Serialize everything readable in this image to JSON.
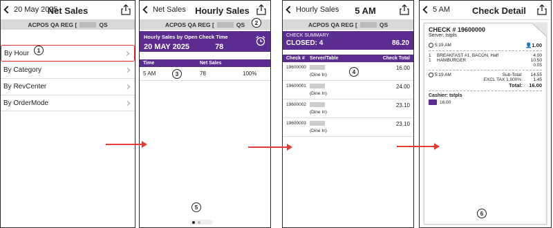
{
  "screen1": {
    "back_label": "20 May 2025",
    "title": "Net Sales",
    "reg_prefix": "ACPOS QA REG [",
    "reg_suffix": "QS",
    "items": [
      {
        "label": "By Hour"
      },
      {
        "label": "By Category"
      },
      {
        "label": "By RevCenter"
      },
      {
        "label": "By OrderMode"
      }
    ]
  },
  "screen2": {
    "back_label": "Net Sales",
    "title": "Hourly Sales",
    "reg_prefix": "ACPOS QA REG [",
    "reg_suffix": "QS",
    "card_title": "Hourly Sales by Open Check Time",
    "card_date": "20 MAY 2025",
    "card_count": "78",
    "col_time": "Time",
    "col_net_sales": "Net Sales",
    "row": {
      "time": "5 AM",
      "count": "78",
      "pct": "100%"
    }
  },
  "screen3": {
    "back_label": "Hourly Sales",
    "title": "5 AM",
    "reg_prefix": "ACPOS QA REG [",
    "reg_suffix": "QS",
    "summary_title": "CHECK SUMMARY",
    "closed_label": "CLOSED: 4",
    "closed_total": "86.20",
    "col_check": "Check #",
    "col_server": "Server/Table",
    "col_total": "Check Total",
    "rows": [
      {
        "check": "19600000",
        "type": "(Dine In)",
        "total": "16.00"
      },
      {
        "check": "19600001",
        "type": "(Dine In)",
        "total": "24.00"
      },
      {
        "check": "19600002",
        "type": "(Dine In)",
        "total": "23.10"
      },
      {
        "check": "19600003",
        "type": "(Dine In)",
        "total": "23.10"
      }
    ]
  },
  "screen4": {
    "back_label": "5 AM",
    "title": "Check Detail",
    "check_no": "CHECK # 19600000",
    "server": "Server: tstpls",
    "open_time": "5:19 AM",
    "guests": "1.00",
    "items": [
      {
        "qty": "1",
        "name": "BREAKFAST #1, BACON, Half",
        "amt": "4.00"
      },
      {
        "qty": "1",
        "name": "HAMBURGER",
        "amt": "10.50"
      },
      {
        "qty": "",
        "name": "",
        "amt": "0.05"
      }
    ],
    "close_time": "5:19 AM",
    "subtotal_label": "Sub-Total:",
    "subtotal": "14.55",
    "tax_label": "EXCL TAX 1,000%:",
    "tax": "1.45",
    "total_label": "Total:",
    "total": "16.00",
    "cashier": "Cashier: tstpls",
    "payment": "16.00"
  },
  "badges": [
    "1",
    "2",
    "3",
    "4",
    "5",
    "6"
  ]
}
